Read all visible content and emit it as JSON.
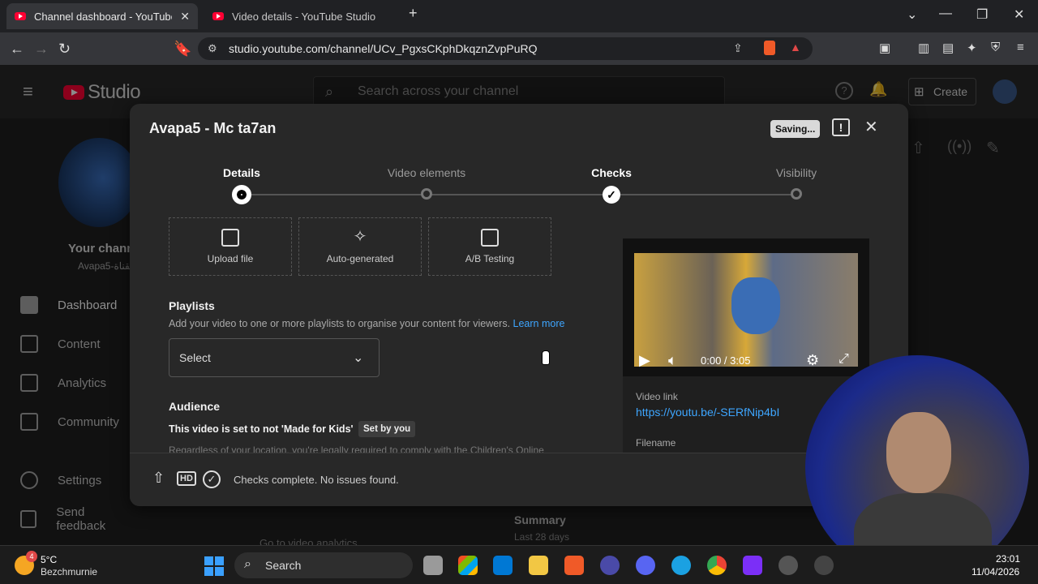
{
  "browser": {
    "tabs": [
      {
        "title": "Channel dashboard - YouTube St",
        "active": true
      },
      {
        "title": "Video details - YouTube Studio",
        "active": false
      }
    ],
    "url": "studio.youtube.com/channel/UCv_PgxsCKphDkqznZvpPuRQ"
  },
  "studio": {
    "logo_text": "Studio",
    "search_placeholder": "Search across your channel",
    "create_label": "Create",
    "channel_label": "Your chann",
    "channel_handle": "Avapa5-القناة",
    "sidebar": [
      {
        "label": "Dashboard",
        "active": true
      },
      {
        "label": "Content",
        "active": false
      },
      {
        "label": "Analytics",
        "active": false
      },
      {
        "label": "Community",
        "active": false
      },
      {
        "label": "Settings",
        "active": false
      },
      {
        "label": "Send feedback",
        "active": false
      }
    ],
    "summary_title": "Summary",
    "summary_sub": "Last 28 days",
    "go_analytics": "Go to video analytics"
  },
  "modal": {
    "title": "Avapa5 - Mc ta7an",
    "saving": "Saving...",
    "steps": [
      {
        "label": "Details",
        "state": "current"
      },
      {
        "label": "Video elements",
        "state": "pending"
      },
      {
        "label": "Checks",
        "state": "done"
      },
      {
        "label": "Visibility",
        "state": "pending"
      }
    ],
    "thumb_options": [
      {
        "label": "Upload file",
        "icon": "add-photo-icon"
      },
      {
        "label": "Auto-generated",
        "icon": "sparkle-icon"
      },
      {
        "label": "A/B Testing",
        "icon": "ab-test-icon"
      }
    ],
    "playlists": {
      "title": "Playlists",
      "desc": "Add your video to one or more playlists to organise your content for viewers.",
      "learn_more": "Learn more",
      "select_value": "Select"
    },
    "audience": {
      "title": "Audience",
      "status": "This video is set to not 'Made for Kids'",
      "badge": "Set by you",
      "fade_text": "Regardless of your location, you're legally required to comply with the Children's Online"
    },
    "footer_status": "Checks complete. No issues found.",
    "video": {
      "time": "0:00 / 3:05",
      "link_label": "Video link",
      "link": "https://youtu.be/-SERfNip4bI",
      "filename_label": "Filename"
    }
  },
  "taskbar": {
    "temp": "5°C",
    "city": "Bezchmurnie",
    "weather_badge": "4",
    "search_label": "Search",
    "time": "23:01",
    "date": "11/04/2026"
  }
}
